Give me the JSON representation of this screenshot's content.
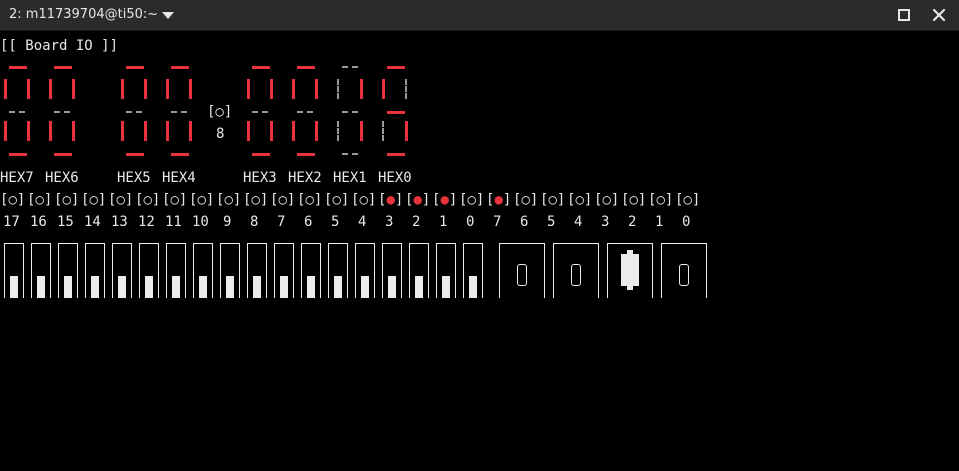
{
  "window": {
    "tab_title": "2: m11739704@ti50:~",
    "controls": [
      "chevron-down-icon",
      "maximize-icon",
      "close-icon"
    ]
  },
  "colors": {
    "background": "#000000",
    "text": "#e8e8e8",
    "segment_on": "#e8323c",
    "segment_off": "#9a9a9a",
    "led_on": "#e8323c"
  },
  "board": {
    "heading": "[[ Board IO ]]",
    "center_indicator": "[○]",
    "center_value": "8",
    "hex_digits": [
      {
        "label": "HEX7",
        "segments": {
          "a": 1,
          "b": 1,
          "c": 1,
          "d": 1,
          "e": 1,
          "f": 1,
          "g": 0
        }
      },
      {
        "label": "HEX6",
        "segments": {
          "a": 1,
          "b": 1,
          "c": 1,
          "d": 1,
          "e": 1,
          "f": 1,
          "g": 0
        }
      },
      {
        "label": "HEX5",
        "segments": {
          "a": 1,
          "b": 1,
          "c": 1,
          "d": 1,
          "e": 1,
          "f": 1,
          "g": 0
        }
      },
      {
        "label": "HEX4",
        "segments": {
          "a": 1,
          "b": 1,
          "c": 1,
          "d": 1,
          "e": 1,
          "f": 1,
          "g": 0
        }
      },
      {
        "label": "HEX3",
        "segments": {
          "a": 1,
          "b": 1,
          "c": 1,
          "d": 1,
          "e": 1,
          "f": 1,
          "g": 0
        }
      },
      {
        "label": "HEX2",
        "segments": {
          "a": 1,
          "b": 1,
          "c": 1,
          "d": 1,
          "e": 1,
          "f": 1,
          "g": 0
        }
      },
      {
        "label": "HEX1",
        "segments": {
          "a": 0,
          "b": 1,
          "c": 1,
          "d": 0,
          "e": 0,
          "f": 0,
          "g": 0
        }
      },
      {
        "label": "HEX0",
        "segments": {
          "a": 1,
          "b": 0,
          "c": 1,
          "d": 1,
          "e": 0,
          "f": 1,
          "g": 1
        }
      }
    ],
    "led_dot": "●",
    "red_leds": {
      "labels": [
        "17",
        "16",
        "15",
        "14",
        "13",
        "12",
        "11",
        "10",
        "9",
        "8",
        "7",
        "6",
        "5",
        "4",
        "3",
        "2",
        "1",
        "0"
      ],
      "on": [
        0,
        0,
        0,
        0,
        0,
        0,
        0,
        0,
        0,
        0,
        0,
        0,
        0,
        0,
        1,
        1,
        1,
        0
      ]
    },
    "green_leds": {
      "labels": [
        "7",
        "6",
        "5",
        "4",
        "3",
        "2",
        "1",
        "0"
      ],
      "on": [
        1,
        0,
        0,
        0,
        0,
        0,
        0,
        0
      ]
    },
    "switches": {
      "positions": [
        "down",
        "down",
        "down",
        "down",
        "down",
        "down",
        "down",
        "down",
        "down",
        "down",
        "down",
        "down",
        "down",
        "down",
        "down",
        "down",
        "down",
        "down"
      ]
    },
    "keys": {
      "pressed": [
        0,
        0,
        1,
        0
      ]
    }
  }
}
